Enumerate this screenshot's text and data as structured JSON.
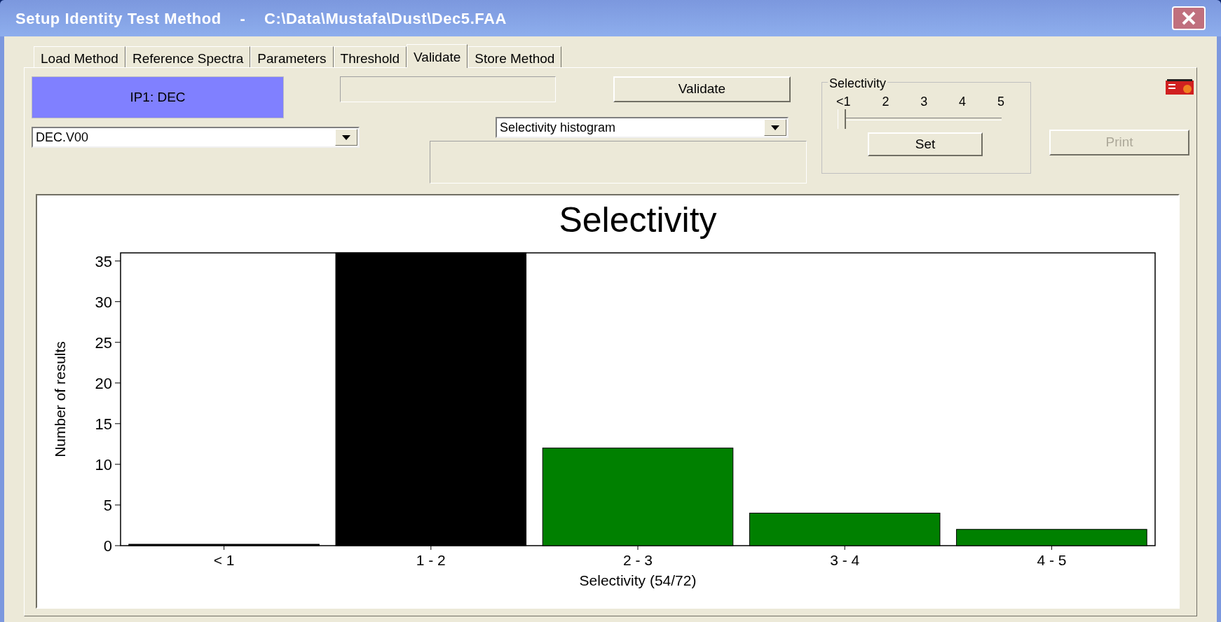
{
  "window": {
    "title": "Setup Identity Test Method    -    C:\\Data\\Mustafa\\Dust\\Dec5.FAA"
  },
  "tabs": [
    {
      "label": "Load Method",
      "selected": false
    },
    {
      "label": "Reference Spectra",
      "selected": false
    },
    {
      "label": "Parameters",
      "selected": false
    },
    {
      "label": "Threshold",
      "selected": false
    },
    {
      "label": "Validate",
      "selected": true
    },
    {
      "label": "Store Method",
      "selected": false
    }
  ],
  "identity_label": "IP1: DEC",
  "method_select": {
    "value": "DEC.V00"
  },
  "validate_button": {
    "label": "Validate",
    "disabled": false
  },
  "view_select": {
    "value": "Selectivity histogram"
  },
  "selectivity_group": {
    "title": "Selectivity",
    "ticks": [
      "<1",
      "2",
      "3",
      "4",
      "5"
    ],
    "level": 0,
    "set_button": "Set"
  },
  "print_button": {
    "label": "Print",
    "disabled": true
  },
  "chart": {
    "chart_data": {
      "type": "bar",
      "title": "Selectivity",
      "xlabel": "Selectivity (54/72)",
      "ylabel": "Number of results",
      "categories": [
        "< 1",
        "1 - 2",
        "2 - 3",
        "3 - 4",
        "4 - 5"
      ],
      "ylim": [
        0,
        36
      ],
      "yticks": [
        0,
        5,
        10,
        15,
        20,
        25,
        30,
        35
      ],
      "values": [
        0,
        36,
        12,
        4,
        2
      ]
    },
    "bars": [
      {
        "color": "#000000"
      },
      {
        "color": "#000000"
      },
      {
        "color": "#008000"
      },
      {
        "color": "#008000"
      },
      {
        "color": "#008000"
      }
    ]
  }
}
